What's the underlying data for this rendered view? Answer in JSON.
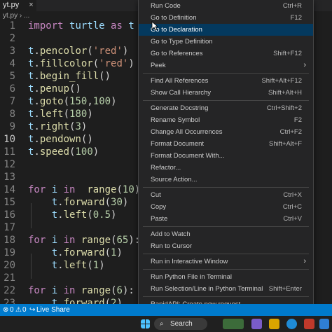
{
  "editor": {
    "tab_title": "yt.py",
    "tab_close": "×",
    "breadcrumb": "yt.py › ...",
    "lines": [
      {
        "n": "1",
        "tokens": [
          [
            "kw",
            "import"
          ],
          [
            "plain",
            " "
          ],
          [
            "id",
            "turtle"
          ],
          [
            "plain",
            " "
          ],
          [
            "kw",
            "as"
          ],
          [
            "plain",
            " "
          ],
          [
            "id",
            "t"
          ]
        ]
      },
      {
        "n": "2",
        "tokens": []
      },
      {
        "n": "3",
        "tokens": [
          [
            "id",
            "t"
          ],
          [
            "plain",
            "."
          ],
          [
            "fn",
            "pencolor"
          ],
          [
            "plain",
            "("
          ],
          [
            "str",
            "'red'"
          ],
          [
            "plain",
            ")"
          ]
        ]
      },
      {
        "n": "4",
        "tokens": [
          [
            "id",
            "t"
          ],
          [
            "plain",
            "."
          ],
          [
            "fn",
            "fillcolor"
          ],
          [
            "plain",
            "("
          ],
          [
            "str",
            "'red'"
          ],
          [
            "plain",
            ")"
          ]
        ]
      },
      {
        "n": "5",
        "tokens": [
          [
            "id",
            "t"
          ],
          [
            "plain",
            "."
          ],
          [
            "fn",
            "begin_fill"
          ],
          [
            "plain",
            "()"
          ]
        ]
      },
      {
        "n": "6",
        "tokens": [
          [
            "id",
            "t"
          ],
          [
            "plain",
            "."
          ],
          [
            "fn",
            "penup"
          ],
          [
            "plain",
            "()"
          ]
        ]
      },
      {
        "n": "7",
        "tokens": [
          [
            "id",
            "t"
          ],
          [
            "plain",
            "."
          ],
          [
            "fn",
            "goto"
          ],
          [
            "plain",
            "("
          ],
          [
            "numlit",
            "150"
          ],
          [
            "plain",
            ","
          ],
          [
            "numlit",
            "100"
          ],
          [
            "plain",
            ")"
          ]
        ]
      },
      {
        "n": "8",
        "tokens": [
          [
            "id",
            "t"
          ],
          [
            "plain",
            "."
          ],
          [
            "fn",
            "left"
          ],
          [
            "plain",
            "("
          ],
          [
            "numlit",
            "180"
          ],
          [
            "plain",
            ")"
          ]
        ]
      },
      {
        "n": "9",
        "tokens": [
          [
            "id",
            "t"
          ],
          [
            "plain",
            "."
          ],
          [
            "fn",
            "right"
          ],
          [
            "plain",
            "("
          ],
          [
            "numlit",
            "3"
          ],
          [
            "plain",
            ")"
          ]
        ]
      },
      {
        "n": "10",
        "tokens": [
          [
            "id",
            "t"
          ],
          [
            "plain",
            "."
          ],
          [
            "fn",
            "pendown"
          ],
          [
            "plain",
            "()"
          ]
        ],
        "active": true
      },
      {
        "n": "11",
        "tokens": [
          [
            "id",
            "t"
          ],
          [
            "plain",
            "."
          ],
          [
            "fn",
            "speed"
          ],
          [
            "plain",
            "("
          ],
          [
            "numlit",
            "100"
          ],
          [
            "plain",
            ")"
          ]
        ]
      },
      {
        "n": "12",
        "tokens": []
      },
      {
        "n": "13",
        "tokens": []
      },
      {
        "n": "14",
        "tokens": [
          [
            "kw",
            "for"
          ],
          [
            "plain",
            " "
          ],
          [
            "id",
            "i"
          ],
          [
            "plain",
            " "
          ],
          [
            "kw",
            "in"
          ],
          [
            "plain",
            "  "
          ],
          [
            "fn",
            "range"
          ],
          [
            "plain",
            "("
          ],
          [
            "numlit",
            "10"
          ],
          [
            "plain",
            "):"
          ]
        ]
      },
      {
        "n": "15",
        "tokens": [
          [
            "plain",
            "    "
          ],
          [
            "id",
            "t"
          ],
          [
            "plain",
            "."
          ],
          [
            "fn",
            "forward"
          ],
          [
            "plain",
            "("
          ],
          [
            "numlit",
            "30"
          ],
          [
            "plain",
            ")"
          ]
        ]
      },
      {
        "n": "16",
        "tokens": [
          [
            "plain",
            "    "
          ],
          [
            "id",
            "t"
          ],
          [
            "plain",
            "."
          ],
          [
            "fn",
            "left"
          ],
          [
            "plain",
            "("
          ],
          [
            "numlit",
            "0.5"
          ],
          [
            "plain",
            ")"
          ]
        ]
      },
      {
        "n": "17",
        "tokens": []
      },
      {
        "n": "18",
        "tokens": [
          [
            "kw",
            "for"
          ],
          [
            "plain",
            " "
          ],
          [
            "id",
            "i"
          ],
          [
            "plain",
            " "
          ],
          [
            "kw",
            "in"
          ],
          [
            "plain",
            " "
          ],
          [
            "fn",
            "range"
          ],
          [
            "plain",
            "("
          ],
          [
            "numlit",
            "65"
          ],
          [
            "plain",
            "):"
          ]
        ]
      },
      {
        "n": "19",
        "tokens": [
          [
            "plain",
            "    "
          ],
          [
            "id",
            "t"
          ],
          [
            "plain",
            "."
          ],
          [
            "fn",
            "forward"
          ],
          [
            "plain",
            "("
          ],
          [
            "numlit",
            "1"
          ],
          [
            "plain",
            ")"
          ]
        ]
      },
      {
        "n": "20",
        "tokens": [
          [
            "plain",
            "    "
          ],
          [
            "id",
            "t"
          ],
          [
            "plain",
            "."
          ],
          [
            "fn",
            "left"
          ],
          [
            "plain",
            "("
          ],
          [
            "numlit",
            "1"
          ],
          [
            "plain",
            ")"
          ]
        ]
      },
      {
        "n": "21",
        "tokens": []
      },
      {
        "n": "22",
        "tokens": [
          [
            "kw",
            "for"
          ],
          [
            "plain",
            " "
          ],
          [
            "id",
            "i"
          ],
          [
            "plain",
            " "
          ],
          [
            "kw",
            "in"
          ],
          [
            "plain",
            " "
          ],
          [
            "fn",
            "range"
          ],
          [
            "plain",
            "("
          ],
          [
            "numlit",
            "6"
          ],
          [
            "plain",
            "):"
          ]
        ]
      },
      {
        "n": "23",
        "tokens": [
          [
            "plain",
            "    "
          ],
          [
            "id",
            "t"
          ],
          [
            "plain",
            "."
          ],
          [
            "fn",
            "forward"
          ],
          [
            "plain",
            "("
          ],
          [
            "numlit",
            "2"
          ],
          [
            "plain",
            ")"
          ]
        ]
      }
    ]
  },
  "context_menu": {
    "items": [
      {
        "label": "Run Code",
        "shortcut": "Ctrl+R"
      },
      {
        "label": "Go to Definition",
        "shortcut": "F12"
      },
      {
        "label": "Go to Declaration",
        "shortcut": "",
        "selected": true
      },
      {
        "label": "Go to Type Definition",
        "shortcut": ""
      },
      {
        "label": "Go to References",
        "shortcut": "Shift+F12"
      },
      {
        "label": "Peek",
        "shortcut": "",
        "submenu": true
      },
      {
        "sep": true
      },
      {
        "label": "Find All References",
        "shortcut": "Shift+Alt+F12"
      },
      {
        "label": "Show Call Hierarchy",
        "shortcut": "Shift+Alt+H"
      },
      {
        "sep": true
      },
      {
        "label": "Generate Docstring",
        "shortcut": "Ctrl+Shift+2"
      },
      {
        "label": "Rename Symbol",
        "shortcut": "F2"
      },
      {
        "label": "Change All Occurrences",
        "shortcut": "Ctrl+F2"
      },
      {
        "label": "Format Document",
        "shortcut": "Shift+Alt+F"
      },
      {
        "label": "Format Document With...",
        "shortcut": ""
      },
      {
        "label": "Refactor...",
        "shortcut": ""
      },
      {
        "label": "Source Action...",
        "shortcut": ""
      },
      {
        "sep": true
      },
      {
        "label": "Cut",
        "shortcut": "Ctrl+X"
      },
      {
        "label": "Copy",
        "shortcut": "Ctrl+C"
      },
      {
        "label": "Paste",
        "shortcut": "Ctrl+V"
      },
      {
        "sep": true
      },
      {
        "label": "Add to Watch",
        "shortcut": ""
      },
      {
        "label": "Run to Cursor",
        "shortcut": ""
      },
      {
        "sep": true
      },
      {
        "label": "Run in Interactive Window",
        "shortcut": "",
        "submenu": true
      },
      {
        "sep": true
      },
      {
        "label": "Run Python File in Terminal",
        "shortcut": ""
      },
      {
        "label": "Run Selection/Line in Python Terminal",
        "shortcut": "Shift+Enter"
      },
      {
        "sep": true
      },
      {
        "label": "RapidAPI: Create new request",
        "shortcut": ""
      }
    ]
  },
  "statusbar": {
    "problems_errors": "0",
    "problems_warnings": "0",
    "live_share": "Live Share"
  },
  "taskbar": {
    "search_label": "Search"
  },
  "colors": {
    "accent": "#007acc",
    "menu_selected": "#04395e"
  }
}
